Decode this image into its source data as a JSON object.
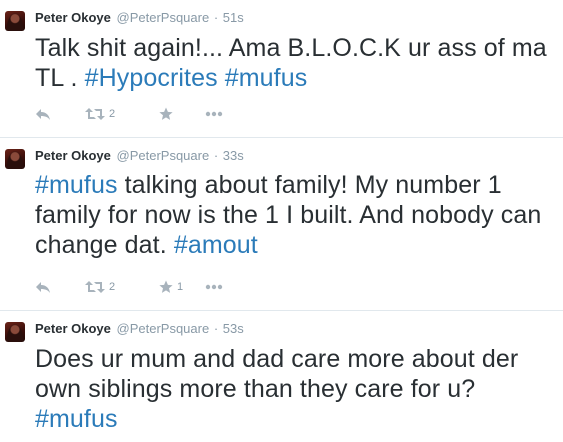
{
  "tweets": [
    {
      "name": "Peter Okoye",
      "handle": "@PeterPsquare",
      "separator": "·",
      "time": "51s",
      "text_before": "Talk shit again!... Ama B.L.O.C.K ur ass of ma TL . ",
      "tag_1": "#Hypocrites",
      "text_middle": " ",
      "tag_2": "#mufus",
      "retweet_count": "2",
      "favorite_count": ""
    },
    {
      "name": "Peter Okoye",
      "handle": "@PeterPsquare",
      "separator": "·",
      "time": "33s",
      "tag_1": "#mufus",
      "text_middle": " talking about family! My number 1 family for now is the 1 I built. And nobody can change dat. ",
      "tag_2": "#amout",
      "retweet_count": "2",
      "favorite_count": "1"
    },
    {
      "name": "Peter Okoye",
      "handle": "@PeterPsquare",
      "separator": "·",
      "time": "53s",
      "text_before": "Does ur mum and dad care more about der own siblings more than they care for u? ",
      "tag_1": "#mufus"
    }
  ],
  "icons": {
    "reply": "reply-icon",
    "retweet": "retweet-icon",
    "favorite": "star-icon",
    "more": "more-icon"
  },
  "colors": {
    "text": "#292f33",
    "meta": "#8899a6",
    "hashtag": "#2b7bb9",
    "icon": "#a8b3bc",
    "divider": "#e1e8ed"
  }
}
